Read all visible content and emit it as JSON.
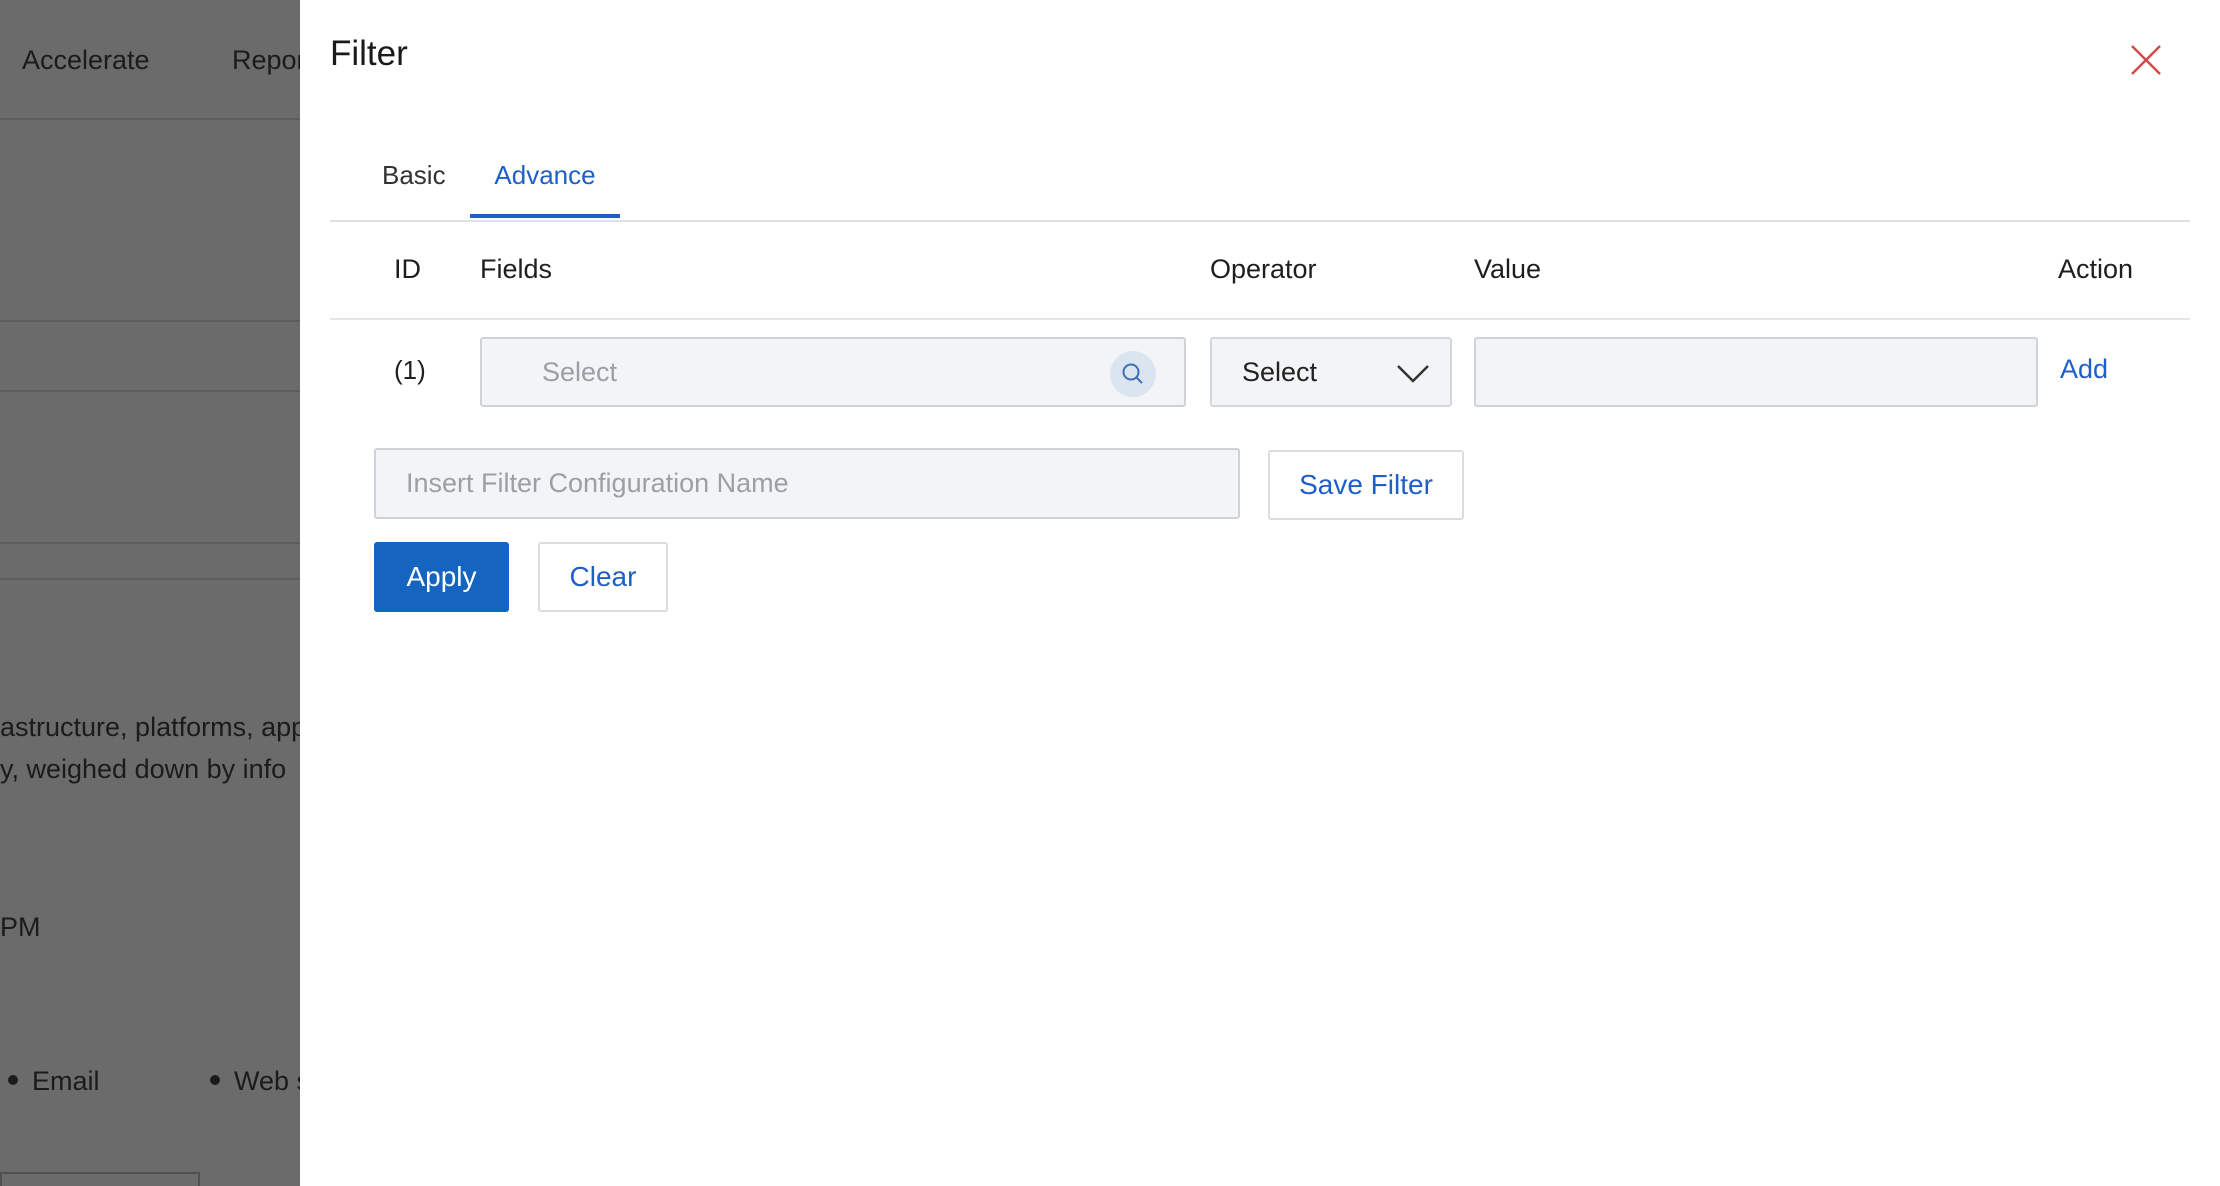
{
  "background": {
    "nav": [
      "Accelerate",
      "Repor"
    ],
    "paragraph_lines": [
      "astructure, platforms, app",
      "y, weighed down by info"
    ],
    "time_suffix": "PM",
    "bullets": [
      "Email",
      "Web s"
    ]
  },
  "modal": {
    "title": "Filter",
    "tabs": [
      {
        "label": "Basic",
        "active": false
      },
      {
        "label": "Advance",
        "active": true
      }
    ],
    "columns": {
      "id": "ID",
      "fields": "Fields",
      "operator": "Operator",
      "value": "Value",
      "action": "Action"
    },
    "row": {
      "id": "(1)",
      "field_placeholder": "Select",
      "operator_value": "Select",
      "value": "",
      "action_label": "Add"
    },
    "config_placeholder": "Insert Filter Configuration Name",
    "buttons": {
      "save": "Save Filter",
      "apply": "Apply",
      "clear": "Clear"
    }
  },
  "colors": {
    "accent": "#1f5fc7",
    "primary_button": "#1565c0",
    "close_icon": "#d04a4a",
    "overlay": "#6b6b6b"
  },
  "icons": {
    "close": "close-icon",
    "search": "search-icon",
    "dropdown": "chevron-down-icon"
  }
}
